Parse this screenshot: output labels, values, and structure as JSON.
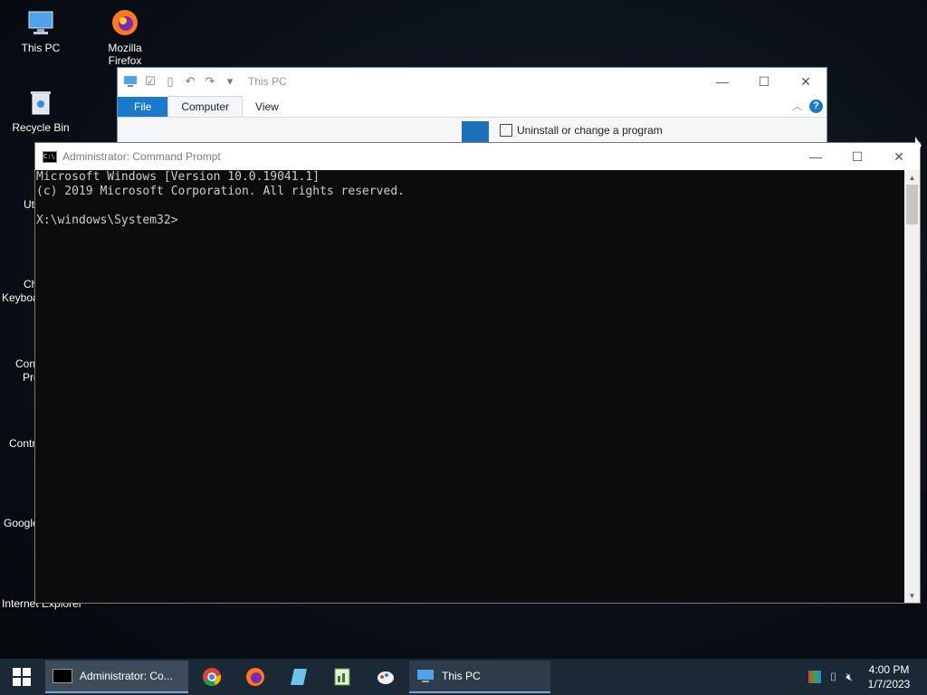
{
  "desktop": {
    "icons": [
      {
        "label": "This PC"
      },
      {
        "label": "Mozilla Firefox"
      },
      {
        "label": "Recycle Bin"
      }
    ],
    "partial_labels": [
      "Uti",
      "Ch",
      "Keyboa",
      "Con",
      "Pro",
      "Contr",
      "Google",
      "Internet Explorer"
    ]
  },
  "explorer": {
    "title": "This PC",
    "tabs": [
      "File",
      "Computer",
      "View"
    ],
    "active_tab": "Computer",
    "uninstall_label": "Uninstall or change a program"
  },
  "cmd": {
    "title": "Administrator: Command Prompt",
    "lines": [
      "Microsoft Windows [Version 10.0.19041.1]",
      "(c) 2019 Microsoft Corporation. All rights reserved.",
      "",
      "X:\\windows\\System32>"
    ]
  },
  "taskbar": {
    "tasks": [
      {
        "label": "Administrator: Co...",
        "state": "active"
      },
      {
        "label": "This PC",
        "state": "inactive"
      }
    ],
    "apps": [
      "chrome-icon",
      "firefox-icon",
      "notepad-icon",
      "spreadsheet-icon",
      "paint-icon"
    ],
    "clock_time": "4:00 PM",
    "clock_date": "1/7/2023"
  }
}
